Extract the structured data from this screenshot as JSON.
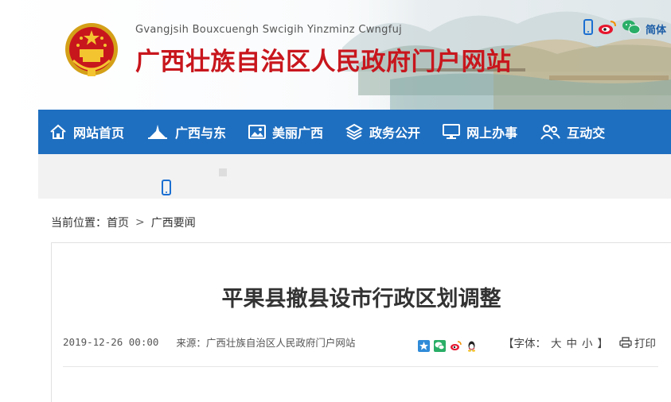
{
  "colors": {
    "brand_red": "#c8161d",
    "nav_blue": "#1f6fc0",
    "grey_band": "#f2f2f2"
  },
  "header": {
    "subtitle": "Gvangjsih Bouxcuengh Swcigih Yinzminz Cwngfuj",
    "title": "广西壮族自治区人民政府门户网站",
    "language_label": "简体"
  },
  "icons": {
    "tools": [
      "mobile-icon",
      "weibo-icon",
      "wechat-icon"
    ],
    "share": [
      "qzone-share-icon",
      "wechat-share-icon",
      "weibo-share-icon",
      "qq-share-icon"
    ]
  },
  "nav": {
    "items": [
      {
        "label": "网站首页",
        "icon": "home-icon"
      },
      {
        "label": "广西与东",
        "icon": "landmark-icon"
      },
      {
        "label": "美丽广西",
        "icon": "photo-icon"
      },
      {
        "label": "政务公开",
        "icon": "layers-icon"
      },
      {
        "label": "网上办事",
        "icon": "monitor-icon"
      },
      {
        "label": "互动交",
        "icon": "users-icon"
      }
    ]
  },
  "breadcrumb": {
    "prefix": "当前位置：",
    "items": [
      "首页",
      "广西要闻"
    ],
    "separator": ">"
  },
  "article": {
    "title": "平果县撤县设市行政区划调整",
    "date": "2019-12-26 00:00",
    "source": "来源：广西壮族自治区人民政府门户网站",
    "font_size_label_open": "【字体：",
    "font_size_options": [
      "大",
      "中",
      "小"
    ],
    "font_size_label_close": "】",
    "print_label": "打印"
  }
}
